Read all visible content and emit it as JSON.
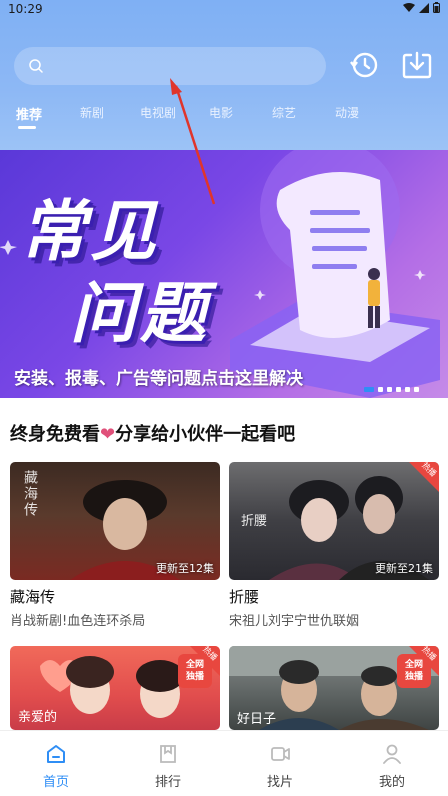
{
  "status_bar": {
    "time": "10:29"
  },
  "colors": {
    "accent": "#2f8ef5",
    "header": "#8db8f5",
    "banner": "#7a47e6",
    "hot": "#e8473f",
    "heart": "#e0507a"
  },
  "search": {
    "placeholder": "",
    "icon": "search-icon"
  },
  "top_actions": [
    {
      "icon": "history-icon"
    },
    {
      "icon": "download-icon"
    }
  ],
  "tabs": [
    "推荐",
    "新剧",
    "电视剧",
    "电影",
    "综艺",
    "动漫"
  ],
  "active_tab": 0,
  "banner": {
    "title_line1": "常见",
    "title_line2": "问题",
    "caption": "安装、报毒、广告等问题点击这里解决",
    "pages": 6,
    "active_page": 0
  },
  "section": {
    "title_prefix": "终身免费看",
    "heart": "❤",
    "title_suffix": "分享给小伙伴一起看吧"
  },
  "cards": [
    {
      "name": "藏海传",
      "desc": "肖战新剧!血色连环杀局",
      "episode": "更新至12集",
      "poster_text": "藏海传",
      "hot": false
    },
    {
      "name": "折腰",
      "desc": "宋祖儿刘宇宁世仇联姻",
      "episode": "更新至21集",
      "poster_text": "折腰",
      "hot": true,
      "hot_label": "热播"
    },
    {
      "name": "",
      "desc": "",
      "episode": "",
      "poster_text": "亲爱的",
      "badge": "全网\n独播",
      "hot": true,
      "hot_label": "热播"
    },
    {
      "name": "",
      "desc": "",
      "episode": "",
      "poster_text": "好日子",
      "badge": "全网\n独播",
      "hot": true,
      "hot_label": "热播"
    }
  ],
  "bottom_nav": [
    {
      "label": "首页",
      "icon": "home-icon"
    },
    {
      "label": "排行",
      "icon": "ranking-icon"
    },
    {
      "label": "找片",
      "icon": "film-icon"
    },
    {
      "label": "我的",
      "icon": "profile-icon"
    }
  ],
  "active_nav": 0
}
